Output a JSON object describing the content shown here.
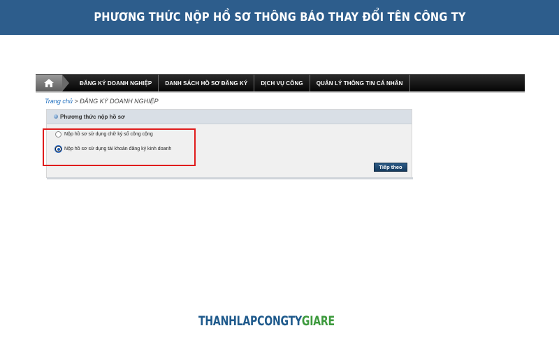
{
  "banner": {
    "title": "PHƯƠNG THỨC NỘP HỒ SƠ THÔNG BÁO THAY ĐỔI TÊN CÔNG TY"
  },
  "nav": {
    "home_icon": "home-icon",
    "items": [
      {
        "label": "ĐĂNG KÝ DOANH NGHIỆP"
      },
      {
        "label": "DANH SÁCH HỒ SƠ ĐĂNG KÝ"
      },
      {
        "label": "DỊCH VỤ CÔNG"
      },
      {
        "label": "QUẢN LÝ THÔNG TIN CÁ NHÂN"
      }
    ]
  },
  "breadcrumb": {
    "home": "Trang chủ",
    "separator": " > ",
    "current": "ĐĂNG KÝ DOANH NGHIỆP"
  },
  "panel": {
    "title": "Phương thức nộp hồ sơ",
    "options": [
      {
        "label": "Nộp hồ sơ sử dụng chữ ký số công cộng",
        "checked": false
      },
      {
        "label": "Nộp hồ sơ sử dụng tài khoản đăng ký kinh doanh",
        "checked": true
      }
    ],
    "next_label": "Tiếp theo"
  },
  "logo": {
    "text_part1": "THANHLAPCONGTY",
    "text_part2": "GIARE"
  },
  "colors": {
    "banner": "#2d5d8c",
    "highlight": "#e01c1c",
    "button": "#1f4a73"
  }
}
